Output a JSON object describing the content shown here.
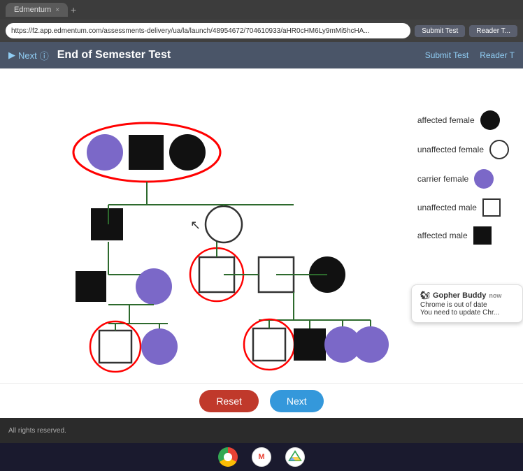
{
  "browser": {
    "tab_label": "Edmentum",
    "tab_close": "×",
    "tab_new": "+",
    "address": "https://f2.app.edmentum.com/assessments-delivery/ua/la/launch/48954672/704610933/aHR0cHM6Ly9mMi5hcHA...",
    "submit_test": "Submit Test",
    "reader_tools": "Reader T..."
  },
  "toolbar": {
    "next_label": "Next",
    "title": "End of Semester Test",
    "submit_label": "Submit Test",
    "reader_label": "Reader T"
  },
  "legend": {
    "affected_female": "affected female",
    "unaffected_female": "unaffected female",
    "carrier_female": "carrier female",
    "unaffected_male": "unaffected male",
    "affected_male": "affected male"
  },
  "buttons": {
    "reset": "Reset",
    "next": "Next"
  },
  "notification": {
    "title": "Gopher Buddy",
    "time": "now",
    "message": "Chrome is out of date",
    "sub": "You need to update Chr..."
  },
  "footer": {
    "text": "All rights reserved."
  }
}
